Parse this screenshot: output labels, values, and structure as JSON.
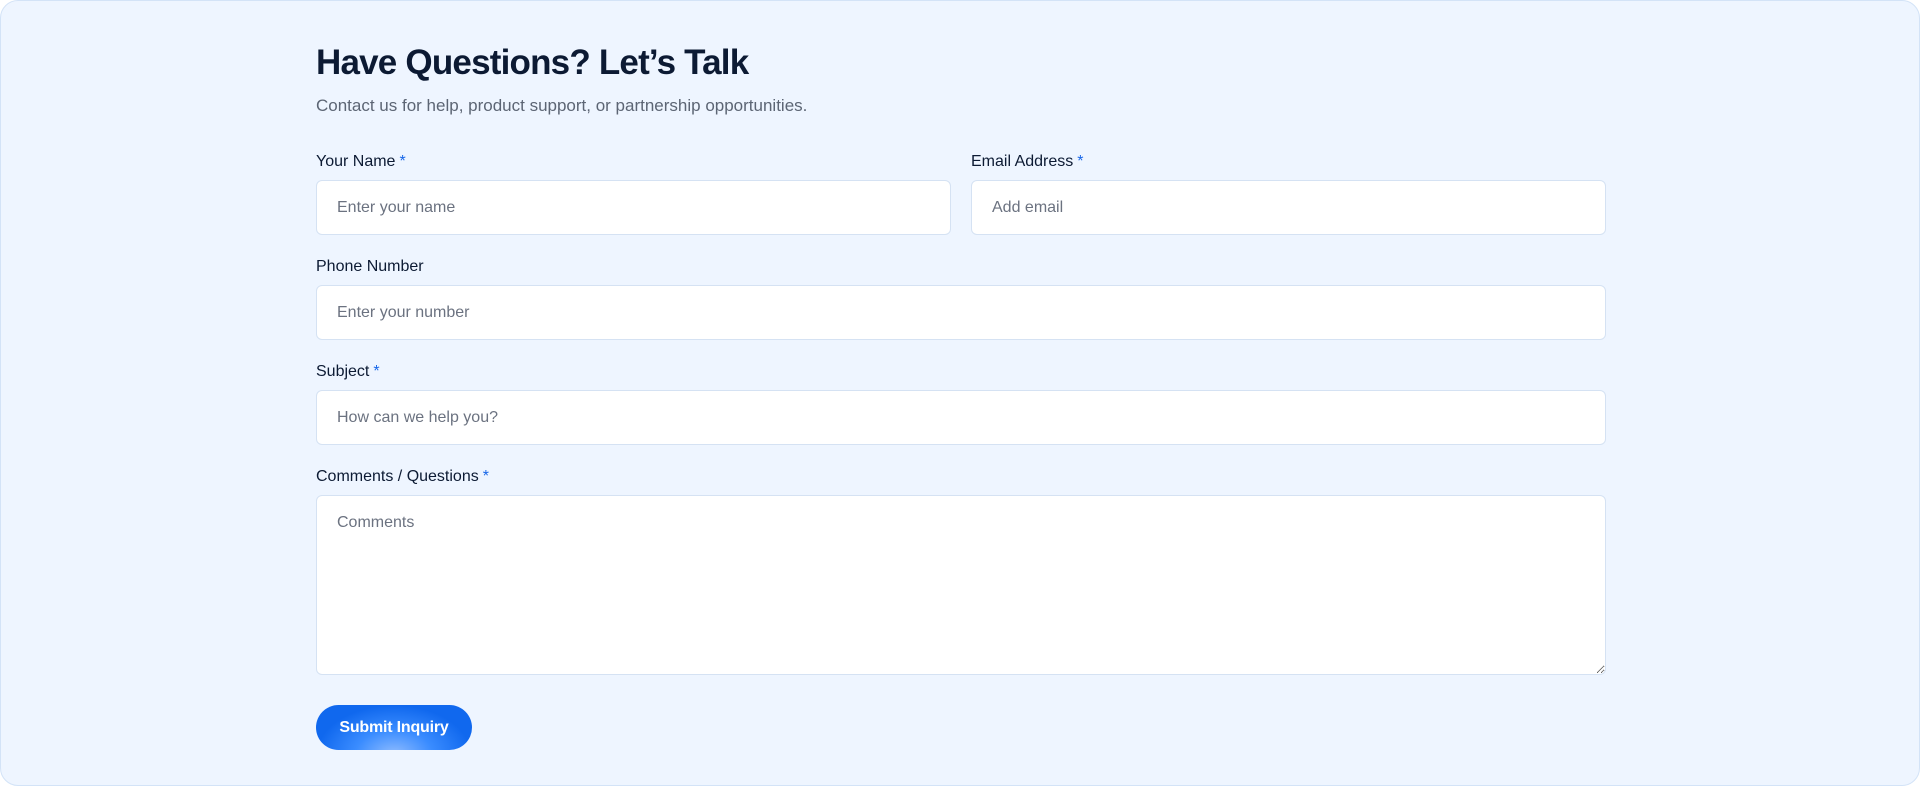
{
  "header": {
    "title": "Have Questions? Let’s Talk",
    "subtitle": "Contact us for help, product support, or partnership opportunities."
  },
  "form": {
    "required_marker": "*",
    "name": {
      "label": "Your Name",
      "placeholder": "Enter your name",
      "value": ""
    },
    "email": {
      "label": "Email Address",
      "placeholder": "Add email",
      "value": ""
    },
    "phone": {
      "label": "Phone Number",
      "placeholder": "Enter your number",
      "value": ""
    },
    "subject": {
      "label": "Subject",
      "placeholder": "How can we help you?",
      "value": ""
    },
    "comments": {
      "label": "Comments / Questions",
      "placeholder": "Comments",
      "value": ""
    },
    "submit_label": "Submit Inquiry"
  },
  "colors": {
    "background": "#eef5ff",
    "heading": "#0c1a33",
    "accent": "#1565e8",
    "muted_text": "#5c6574"
  }
}
